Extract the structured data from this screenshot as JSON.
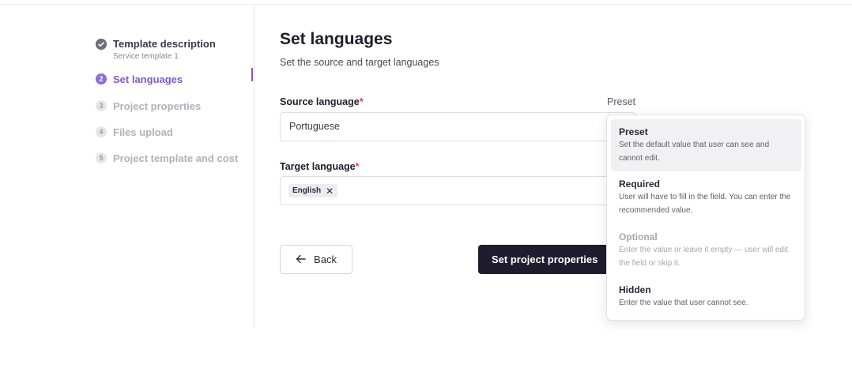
{
  "stepper": {
    "steps": [
      {
        "number": "1",
        "label": "Template description",
        "sublabel": "Service template 1",
        "state": "done"
      },
      {
        "number": "2",
        "label": "Set languages",
        "state": "active"
      },
      {
        "number": "3",
        "label": "Project properties",
        "state": "pending"
      },
      {
        "number": "4",
        "label": "Files upload",
        "state": "pending"
      },
      {
        "number": "5",
        "label": "Project template and cost",
        "state": "pending"
      }
    ]
  },
  "main": {
    "title": "Set languages",
    "subtitle": "Set the source and target languages",
    "source": {
      "label": "Source language",
      "required_mark": "*",
      "value": "Portuguese"
    },
    "preset_label": "Preset",
    "target": {
      "label": "Target language",
      "required_mark": "*",
      "chips": [
        {
          "label": "English"
        }
      ]
    },
    "back_label": "Back",
    "primary_label": "Set project properties"
  },
  "dropdown": {
    "options": [
      {
        "title": "Preset",
        "description": "Set the default value that user can see and cannot edit.",
        "state": "selected"
      },
      {
        "title": "Required",
        "description": "User will have to fill in the field. You can enter the recommended value.",
        "state": "normal"
      },
      {
        "title": "Optional",
        "description": "Enter the value or leave it empty — user will edit the field or skip it.",
        "state": "disabled"
      },
      {
        "title": "Hidden",
        "description": "Enter the value that user cannot see.",
        "state": "normal"
      }
    ]
  },
  "colors": {
    "accent": "#8059c8",
    "primary_button": "#1f1c2e",
    "required": "#e23d4b"
  }
}
